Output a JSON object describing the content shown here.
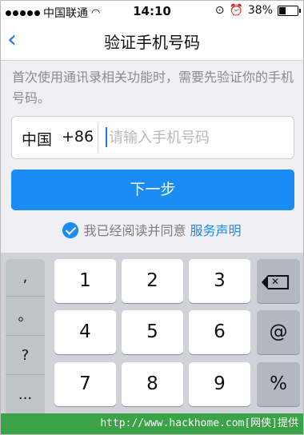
{
  "status_bar": {
    "carrier": "中国联通",
    "time": "14:10",
    "battery": "38%",
    "battery_level": 0.38
  },
  "nav": {
    "back_icon": "chevron-left-icon",
    "title": "验证手机号码"
  },
  "hint": "首次使用通讯录相关功能时，需要先验证你的手机号码。",
  "phone_input": {
    "country": "中国",
    "code": "+86",
    "placeholder": "请输入手机号码",
    "value": ""
  },
  "next_button": "下一步",
  "agreement": {
    "text": "我已经阅读并同意",
    "link": "服务声明",
    "checked": true
  },
  "keyboard": {
    "symbols": [
      ",",
      "。",
      "?",
      "..."
    ],
    "keys": [
      "1",
      "2",
      "3",
      "4",
      "5",
      "6",
      "7",
      "8",
      "9"
    ],
    "at": "@",
    "percent": "%",
    "delete_icon": "backspace-icon"
  },
  "footer": "http://www.hackhome.com[网侠]提供",
  "colors": {
    "accent": "#1a8cf4",
    "footer": "#3aa247"
  }
}
